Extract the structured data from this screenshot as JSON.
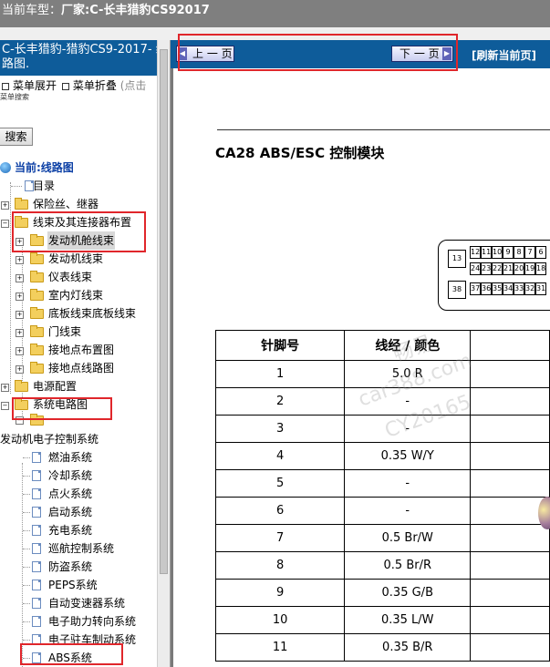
{
  "titlebar": {
    "prefix": "当前车型：",
    "model": "厂家:C-长丰猎豹CS92017"
  },
  "sidebar": {
    "header": "C-长丰猎豹-猎豹CS9-2017- 线路图.",
    "expand_all": "菜单展开",
    "collapse_all": "菜单折叠",
    "collapse_hint": "(点击",
    "menu_search_title": "菜单搜索",
    "search_button": "搜索",
    "tree": [
      {
        "label": "当前:线路图",
        "icon": "globe-icon"
      },
      {
        "label": "目录",
        "icon": "document-icon"
      },
      {
        "label": "保险丝、继器",
        "icon": "folder-icon"
      },
      {
        "label": "线束及其连接器布置",
        "icon": "folder-icon"
      },
      {
        "label": "发动机舱线束",
        "icon": "folder-icon"
      },
      {
        "label": "发动机线束",
        "icon": "folder-icon"
      },
      {
        "label": "仪表线束",
        "icon": "folder-icon"
      },
      {
        "label": "室内灯线束",
        "icon": "folder-icon"
      },
      {
        "label": "底板线束底板线束",
        "icon": "folder-icon"
      },
      {
        "label": "门线束",
        "icon": "folder-icon"
      },
      {
        "label": "接地点布置图",
        "icon": "folder-icon"
      },
      {
        "label": "接地点线路图",
        "icon": "folder-icon"
      },
      {
        "label": "电源配置",
        "icon": "folder-icon"
      },
      {
        "label": "系统电路图",
        "icon": "folder-icon"
      },
      {
        "label": "发动机电子控制系统",
        "icon": "folder-icon"
      },
      {
        "label": "燃油系统",
        "icon": "document-icon"
      },
      {
        "label": "冷却系统",
        "icon": "document-icon"
      },
      {
        "label": "点火系统",
        "icon": "document-icon"
      },
      {
        "label": "启动系统",
        "icon": "document-icon"
      },
      {
        "label": "充电系统",
        "icon": "document-icon"
      },
      {
        "label": "巡航控制系统",
        "icon": "document-icon"
      },
      {
        "label": "防盗系统",
        "icon": "document-icon"
      },
      {
        "label": "PEPS系统",
        "icon": "document-icon"
      },
      {
        "label": "自动变速器系统",
        "icon": "document-icon"
      },
      {
        "label": "电子助力转向系统",
        "icon": "document-icon"
      },
      {
        "label": "电子驻车制动系统",
        "icon": "document-icon"
      },
      {
        "label": "ABS系统",
        "icon": "document-icon"
      }
    ]
  },
  "toolbar": {
    "prev": "上 一 页",
    "next": "下 一 页",
    "refresh": "[刷新当前页]"
  },
  "document": {
    "title": "CA28 ABS/ESC 控制模块",
    "connector_pins": {
      "big": [
        "13",
        "38"
      ],
      "top_row": [
        "12",
        "11",
        "10",
        "9",
        "8",
        "7",
        "6"
      ],
      "mid_row": [
        "24",
        "23",
        "22",
        "21",
        "20",
        "19",
        "18"
      ],
      "bottom_row": [
        "37",
        "36",
        "35",
        "34",
        "33",
        "32",
        "31"
      ]
    },
    "table": {
      "headers": [
        "针脚号",
        "线经 / 颜色"
      ],
      "rows": [
        [
          "1",
          "5.0 R"
        ],
        [
          "2",
          "-"
        ],
        [
          "3",
          "-"
        ],
        [
          "4",
          "0.35 W/Y"
        ],
        [
          "5",
          "-"
        ],
        [
          "6",
          "-"
        ],
        [
          "7",
          "0.5 Br/W"
        ],
        [
          "8",
          "0.5 Br/R"
        ],
        [
          "9",
          "0.35 G/B"
        ],
        [
          "10",
          "0.35 L/W"
        ],
        [
          "11",
          "0.35 B/R"
        ]
      ]
    },
    "watermark": [
      "畅易",
      "car388.com",
      "CY20165"
    ]
  },
  "colors": {
    "header_blue": "#0e5c9a",
    "highlight_red": "#e0262b",
    "titlebar_grey": "#7f7f7f"
  }
}
